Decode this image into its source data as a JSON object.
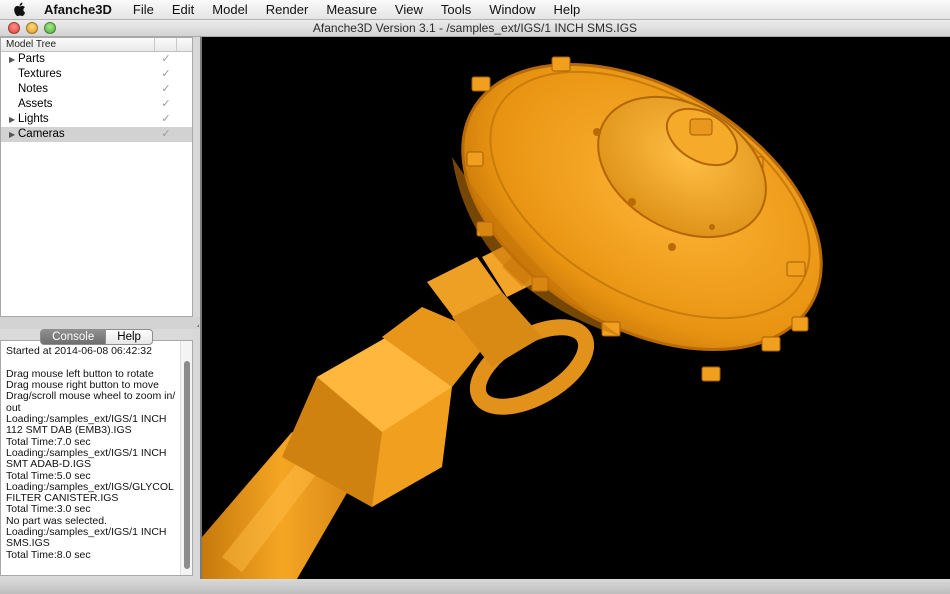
{
  "menubar": {
    "app_name": "Afanche3D",
    "items": [
      "File",
      "Edit",
      "Model",
      "Render",
      "Measure",
      "View",
      "Tools",
      "Window",
      "Help"
    ]
  },
  "window": {
    "title": "Afanche3D Version 3.1 - /samples_ext/IGS/1 INCH SMS.IGS"
  },
  "model_tree": {
    "header": "Model Tree",
    "rows": [
      {
        "label": "Parts",
        "expandable": true,
        "checked": true,
        "selected": false
      },
      {
        "label": "Textures",
        "expandable": false,
        "checked": true,
        "selected": false
      },
      {
        "label": "Notes",
        "expandable": false,
        "checked": true,
        "selected": false
      },
      {
        "label": "Assets",
        "expandable": false,
        "checked": true,
        "selected": false
      },
      {
        "label": "Lights",
        "expandable": true,
        "checked": true,
        "selected": false
      },
      {
        "label": "Cameras",
        "expandable": true,
        "checked": true,
        "selected": true
      }
    ]
  },
  "console_panel": {
    "tabs": [
      {
        "label": "Console",
        "active": true
      },
      {
        "label": "Help",
        "active": false
      }
    ],
    "lines": [
      "Started at 2014-06-08 06:42:32",
      "",
      "Drag mouse left button to rotate",
      "Drag mouse right button to move",
      "Drag/scroll mouse wheel to zoom in/",
      "out",
      "Loading:/samples_ext/IGS/1 INCH",
      "112 SMT DAB (EMB3).IGS",
      "Total Time:7.0 sec",
      "Loading:/samples_ext/IGS/1 INCH",
      "SMT ADAB-D.IGS",
      "Total Time:5.0 sec",
      "Loading:/samples_ext/IGS/GLYCOL",
      "FILTER CANISTER.IGS",
      "Total Time:3.0 sec",
      "No part was selected.",
      "Loading:/samples_ext/IGS/1 INCH",
      "SMS.IGS",
      "Total Time:8.0 sec"
    ]
  },
  "viewport": {
    "background": "#000000",
    "model_color": "#f0a01e",
    "model_shadow": "#b86a06",
    "model_highlight": "#ffc04a"
  },
  "icons": {
    "apple": "apple-logo-icon",
    "expand": "disclosure-triangle-icon",
    "check": "checkmark-icon"
  }
}
